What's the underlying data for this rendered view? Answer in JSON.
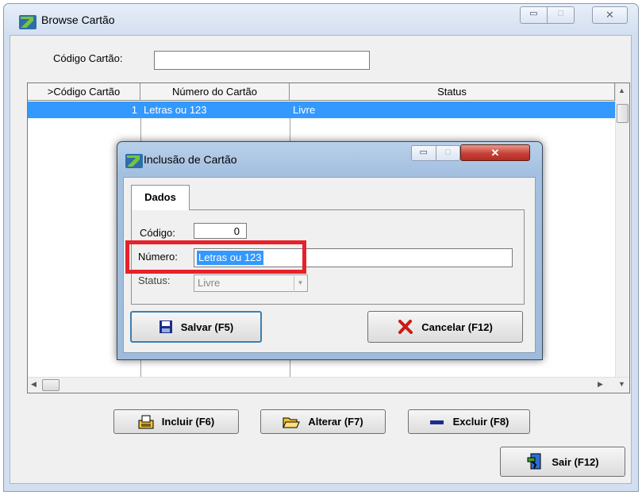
{
  "main_window": {
    "title": "Browse Cartão",
    "caption_buttons": {
      "minimize": "▭",
      "maximize": "□",
      "close": "✕"
    }
  },
  "search": {
    "label": "Código Cartão:",
    "value": ""
  },
  "grid": {
    "columns": [
      ">Código Cartão",
      "Número do Cartão",
      "Status"
    ],
    "rows": [
      {
        "codigo": "1",
        "numero": "Letras ou 123",
        "status": "Livre",
        "selected": true
      }
    ]
  },
  "toolbar": {
    "incluir": "Incluir (F6)",
    "alterar": "Alterar (F7)",
    "excluir": "Excluir (F8)",
    "sair": "Sair (F12)"
  },
  "dialog": {
    "title": "Inclusão de Cartão",
    "tab": "Dados",
    "fields": {
      "codigo_label": "Código:",
      "codigo_value": "0",
      "numero_label": "Número:",
      "numero_value": "Letras ou 123",
      "status_label": "Status:",
      "status_value": "Livre"
    },
    "buttons": {
      "salvar": "Salvar (F5)",
      "cancelar": "Cancelar (F12)"
    }
  },
  "colors": {
    "selection": "#3399ff",
    "highlight_box": "#e8202a",
    "close_button": "#c7413a"
  }
}
